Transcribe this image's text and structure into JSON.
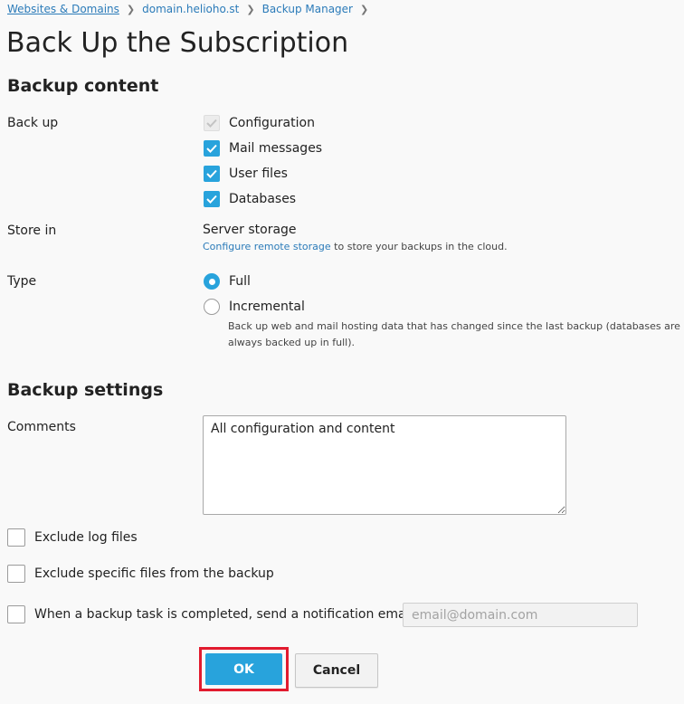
{
  "breadcrumb": {
    "items": [
      "Websites & Domains",
      "domain.helioho.st",
      "Backup Manager"
    ],
    "separator": ">"
  },
  "page_title": "Back Up the Subscription",
  "backup_content": {
    "heading": "Backup content",
    "backup_label": "Back up",
    "options": [
      {
        "label": "Configuration",
        "checked": true,
        "disabled": true
      },
      {
        "label": "Mail messages",
        "checked": true,
        "disabled": false
      },
      {
        "label": "User files",
        "checked": true,
        "disabled": false
      },
      {
        "label": "Databases",
        "checked": true,
        "disabled": false
      }
    ],
    "store_label": "Store in",
    "store_value": "Server storage",
    "remote_link": "Configure remote storage",
    "remote_suffix": "to store your backups in the cloud.",
    "type_label": "Type",
    "type_full": "Full",
    "type_incremental": "Incremental",
    "type_selected": "Full",
    "incremental_hint_1": "Back up web and mail hosting data that has changed since the last backup (databases are",
    "incremental_hint_2": "always backed up in full)."
  },
  "backup_settings": {
    "heading": "Backup settings",
    "comments_label": "Comments",
    "comments_value": "All configuration and content",
    "exclude_log": "Exclude log files",
    "exclude_specific": "Exclude specific files from the backup",
    "notify_label": "When a backup task is completed, send a notification email to",
    "email_placeholder": "email@domain.com"
  },
  "buttons": {
    "ok": "OK",
    "cancel": "Cancel"
  },
  "colors": {
    "accent": "#28a3dc",
    "link": "#2b7bb9",
    "highlight": "#e21b2e"
  }
}
